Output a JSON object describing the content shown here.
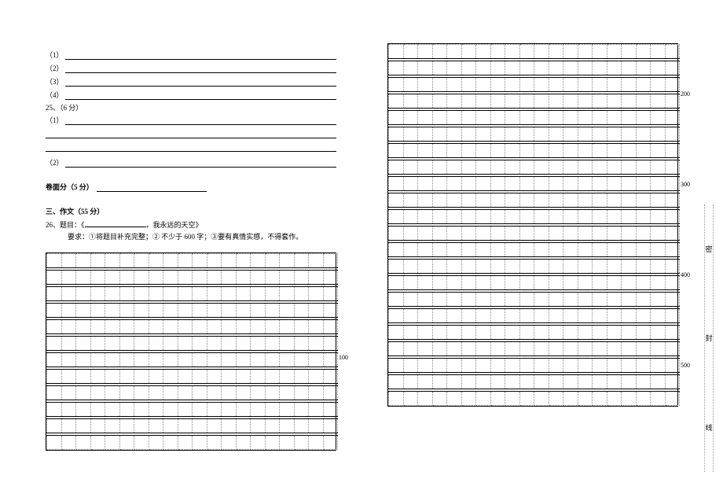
{
  "left": {
    "q1": "（1）",
    "q2": "（2）",
    "q3": "（3）",
    "q4": "（4）",
    "q25": "25、（6 分）",
    "q25_1": "（1）",
    "q25_2": "（2）",
    "juanmian_label": "卷面分（5 分）",
    "section3_title": "三、作文（55 分）",
    "q26_prefix": "26、题目：《",
    "q26_suffix": "，我永远的天空》",
    "req": "要求：①将题目补充完整；② 不少于 600 字；③要有真情实感，不得套作。",
    "marker_100": "100"
  },
  "right": {
    "marker_200": "200",
    "marker_300": "300",
    "marker_400": "400",
    "marker_500": "500"
  },
  "gutter": {
    "c1": "密",
    "c2": "封",
    "c3": "线"
  },
  "chart_data": {
    "type": "table",
    "left_grid": {
      "cols": 20,
      "row_groups": 12,
      "marker_positions": {
        "100": 5
      }
    },
    "right_grid": {
      "cols": 20,
      "row_groups": 22,
      "marker_positions": {
        "200": 2,
        "300": 7,
        "400": 12,
        "500": 17
      }
    }
  }
}
